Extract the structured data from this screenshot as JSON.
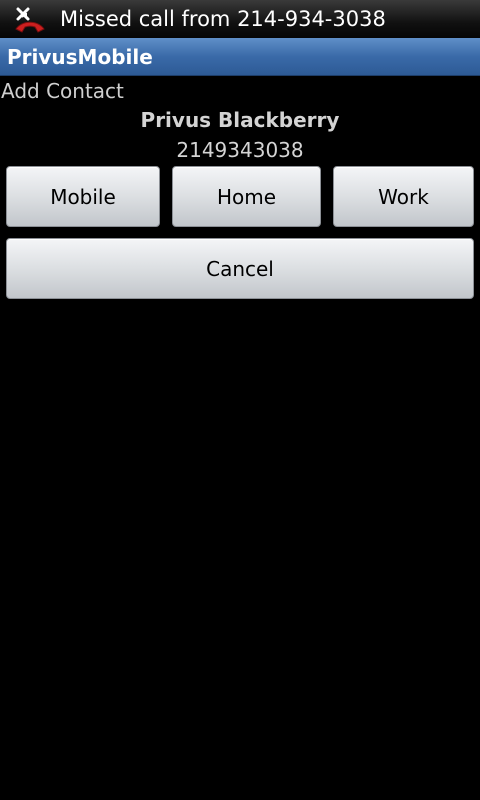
{
  "status_bar": {
    "notification_icon": "missed-call-icon",
    "notification_text": "Missed call from 214-934-3038"
  },
  "title_bar": {
    "app_title": "PrivusMobile"
  },
  "screen": {
    "label": "Add Contact",
    "contact_name": "Privus Blackberry",
    "contact_number": "2149343038"
  },
  "buttons": {
    "mobile_label": "Mobile",
    "home_label": "Home",
    "work_label": "Work",
    "cancel_label": "Cancel"
  },
  "colors": {
    "title_bar": "#3a6aa8",
    "background": "#000000",
    "missed_call_icon": "#cc1f1f"
  }
}
